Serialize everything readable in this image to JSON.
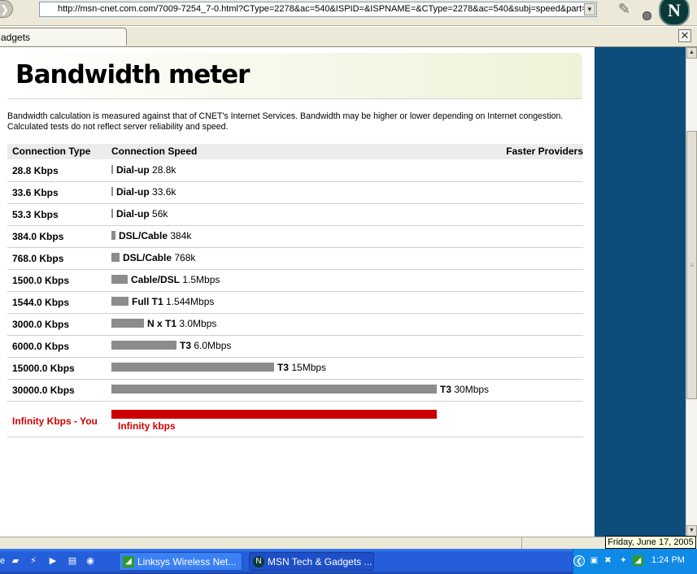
{
  "browser": {
    "url": "http://msn-cnet.com.com/7009-7254_7-0.html?CType=2278&ac=540&ISPID=&ISPNAME=&CType=2278&ac=540&subj=speed&part=",
    "tab_title": "adgets",
    "close_glyph": "✕"
  },
  "page": {
    "title": "Bandwidth meter",
    "description_line1": "Bandwidth calculation is measured against that of CNET's Internet Services. Bandwidth may be higher or lower depending on Internet congestion.",
    "description_line2": "Calculated tests do not reflect server reliability and speed.",
    "headers": {
      "connection_type": "Connection Type",
      "connection_speed": "Connection Speed",
      "faster_providers": "Faster Providers"
    },
    "rows": [
      {
        "kbps": "28.8 Kbps",
        "type": "Dial-up",
        "speed": "28.8k",
        "bar_kbps": 28.8
      },
      {
        "kbps": "33.6 Kbps",
        "type": "Dial-up",
        "speed": "33.6k",
        "bar_kbps": 33.6
      },
      {
        "kbps": "53.3 Kbps",
        "type": "Dial-up",
        "speed": "56k",
        "bar_kbps": 53.3
      },
      {
        "kbps": "384.0 Kbps",
        "type": "DSL/Cable",
        "speed": "384k",
        "bar_kbps": 384
      },
      {
        "kbps": "768.0 Kbps",
        "type": "DSL/Cable",
        "speed": "768k",
        "bar_kbps": 768
      },
      {
        "kbps": "1500.0 Kbps",
        "type": "Cable/DSL",
        "speed": "1.5Mbps",
        "bar_kbps": 1500
      },
      {
        "kbps": "1544.0 Kbps",
        "type": "Full T1",
        "speed": "1.544Mbps",
        "bar_kbps": 1544
      },
      {
        "kbps": "3000.0 Kbps",
        "type": "N x T1",
        "speed": "3.0Mbps",
        "bar_kbps": 3000
      },
      {
        "kbps": "6000.0 Kbps",
        "type": "T3",
        "speed": "6.0Mbps",
        "bar_kbps": 6000
      },
      {
        "kbps": "15000.0 Kbps",
        "type": "T3",
        "speed": "15Mbps",
        "bar_kbps": 15000
      },
      {
        "kbps": "30000.0 Kbps",
        "type": "T3",
        "speed": "30Mbps",
        "bar_kbps": 30000
      }
    ],
    "you": {
      "label": "Infinity Kbps - You",
      "speed": "Infinity kbps",
      "bar_color": "#cc0000"
    }
  },
  "status": {
    "date_tooltip": "Friday, June 17, 2005"
  },
  "taskbar": {
    "tasks": [
      {
        "label": "Linksys Wireless Net...",
        "icon": "linksys-icon"
      },
      {
        "label": "MSN Tech & Gadgets ...",
        "icon": "netscape-icon"
      }
    ],
    "clock": "1:24 PM"
  },
  "colors": {
    "accent_blue": "#0d4d7b",
    "bar_gray": "#8c8c8c",
    "you_red": "#d00000"
  }
}
